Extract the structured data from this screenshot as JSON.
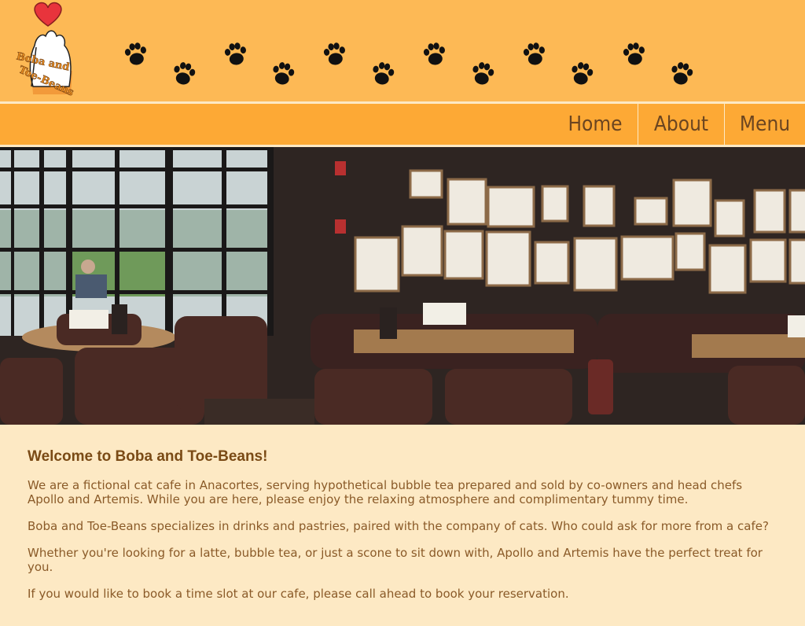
{
  "header": {
    "logo_text_line1": "Boba and",
    "logo_text_line2": "Toe-Beans",
    "logo_alt": "Boba and Toe-Beans logo"
  },
  "nav": {
    "items": [
      {
        "label": "Home"
      },
      {
        "label": "About"
      },
      {
        "label": "Menu"
      }
    ]
  },
  "hero": {
    "alt": "Cafe interior with leather chairs, tables and framed art"
  },
  "content": {
    "title": "Welcome to Boba and Toe-Beans!",
    "paragraphs": [
      "We are a fictional cat cafe in Anacortes, serving hypothetical bubble tea prepared and sold by co-owners and head chefs Apollo and Artemis. While you are here, please enjoy the relaxing atmosphere and complimentary tummy time.",
      "Boba and Toe-Beans specializes in drinks and pastries, paired with the company of cats. Who could ask for more from a cafe?",
      "Whether you're looking for a latte, bubble tea, or just a scone to sit down with, Apollo and Artemis have the perfect treat for you.",
      "If you would like to book a time slot at our cafe, please call ahead to book your reservation."
    ]
  },
  "colors": {
    "header_bg": "#fdb955",
    "nav_bg": "#fda935",
    "page_bg": "#fde9c4",
    "text_brown": "#8a5a28"
  }
}
